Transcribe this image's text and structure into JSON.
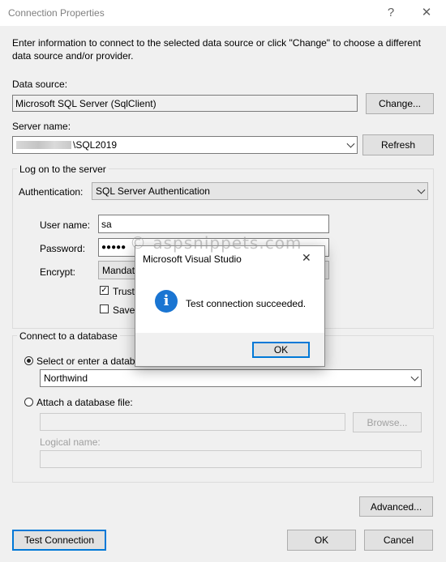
{
  "window": {
    "title": "Connection Properties",
    "help_glyph": "?",
    "close_glyph": "✕"
  },
  "intro": "Enter information to connect to the selected data source or click \"Change\" to choose a different data source and/or provider.",
  "data_source": {
    "label": "Data source:",
    "value": "Microsoft SQL Server (SqlClient)",
    "change_label": "Change..."
  },
  "server": {
    "label": "Server name:",
    "value_visible": "\\SQL2019",
    "refresh_label": "Refresh"
  },
  "logon": {
    "group_label": "Log on to the server",
    "auth_label": "Authentication:",
    "auth_value": "SQL Server Authentication",
    "user_label": "User name:",
    "user_value": "sa",
    "password_label": "Password:",
    "password_mask": "●●●●●",
    "encrypt_label": "Encrypt:",
    "encrypt_value": "Mandat",
    "trust_label": "Trust",
    "save_label": "Save"
  },
  "database": {
    "group_label": "Connect to a database",
    "select_label": "Select or enter a databa",
    "select_value": "Northwind",
    "attach_label": "Attach a database file:",
    "browse_label": "Browse...",
    "logical_label": "Logical name:"
  },
  "buttons": {
    "advanced": "Advanced...",
    "test": "Test Connection",
    "ok": "OK",
    "cancel": "Cancel"
  },
  "modal": {
    "title": "Microsoft Visual Studio",
    "close_glyph": "✕",
    "icon_glyph": "i",
    "message": "Test connection succeeded.",
    "ok": "OK"
  },
  "watermark": "© aspsnippets.com",
  "colors": {
    "accent": "#0078d7",
    "info_icon": "#1a75d2",
    "window_bg": "#f0f0f0"
  }
}
